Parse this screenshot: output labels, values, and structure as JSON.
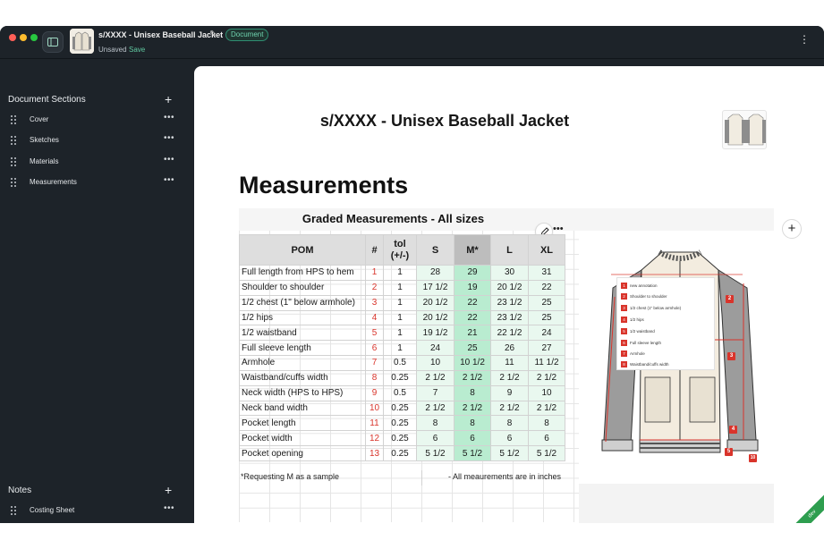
{
  "titlebar": {
    "doc_title": "s/XXXX - Unisex Baseball Jacket",
    "doc_badge": "Document",
    "unsaved": "Unsaved",
    "save": "Save",
    "traffic_colors": [
      "#ff5f57",
      "#febc2e",
      "#28c840"
    ]
  },
  "sidebar": {
    "sections_header": "Document Sections",
    "sections": [
      {
        "label": "Cover"
      },
      {
        "label": "Sketches"
      },
      {
        "label": "Materials"
      },
      {
        "label": "Measurements"
      }
    ],
    "notes_header": "Notes",
    "notes": [
      {
        "label": "Costing Sheet"
      }
    ]
  },
  "page": {
    "title": "s/XXXX - Unisex Baseball Jacket",
    "section_title": "Measurements",
    "sheet_title": "Graded Measurements - All sizes",
    "table": {
      "headers": [
        "POM",
        "#",
        "tol\n(+/-)",
        "S",
        "M*",
        "L",
        "XL"
      ],
      "rows": [
        [
          "Full length from HPS to hem",
          "1",
          "1",
          "28",
          "29",
          "30",
          "31"
        ],
        [
          "Shoulder to shoulder",
          "2",
          "1",
          "17 1/2",
          "19",
          "20 1/2",
          "22"
        ],
        [
          "1/2 chest (1\" below armhole)",
          "3",
          "1",
          "20 1/2",
          "22",
          "23 1/2",
          "25"
        ],
        [
          "1/2 hips",
          "4",
          "1",
          "20 1/2",
          "22",
          "23 1/2",
          "25"
        ],
        [
          "1/2 waistband",
          "5",
          "1",
          "19 1/2",
          "21",
          "22 1/2",
          "24"
        ],
        [
          "Full sleeve length",
          "6",
          "1",
          "24",
          "25",
          "26",
          "27"
        ],
        [
          "Armhole",
          "7",
          "0.5",
          "10",
          "10 1/2",
          "11",
          "11 1/2"
        ],
        [
          "Waistband/cuffs width",
          "8",
          "0.25",
          "2 1/2",
          "2 1/2",
          "2 1/2",
          "2 1/2"
        ],
        [
          "Neck width (HPS to HPS)",
          "9",
          "0.5",
          "7",
          "8",
          "9",
          "10"
        ],
        [
          "Neck band width",
          "10",
          "0.25",
          "2 1/2",
          "2 1/2",
          "2 1/2",
          "2 1/2"
        ],
        [
          "Pocket length",
          "11",
          "0.25",
          "8",
          "8",
          "8",
          "8"
        ],
        [
          "Pocket width",
          "12",
          "0.25",
          "6",
          "6",
          "6",
          "6"
        ],
        [
          "Pocket opening",
          "13",
          "0.25",
          "5 1/2",
          "5 1/2",
          "5 1/2",
          "5 1/2"
        ]
      ],
      "note_left": "*Requesting M as a sample",
      "note_right": "- All meaurements are in inches"
    },
    "callouts": [
      "new annotation",
      "Shoulder to shoulder",
      "1/2 chest (1\" below armhole)",
      "1/2 hips",
      "1/2 waistband",
      "Full sleeve length",
      "Armhole",
      "Waistband/cuffs width"
    ],
    "pins": [
      "2",
      "3",
      "4",
      "5",
      "10"
    ],
    "ribbon": "dev"
  },
  "colors": {
    "accent": "#61c9a1",
    "highlight_m": "#b9ecd0",
    "annotation_red": "#d9342b"
  }
}
